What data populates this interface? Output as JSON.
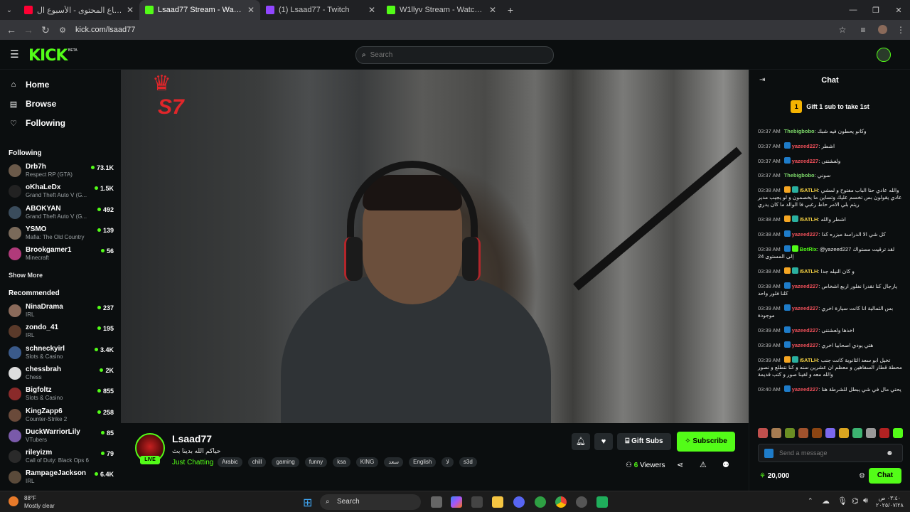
{
  "browser": {
    "tabs": [
      {
        "title": "دوري صناع المحتوى - الأسبوع ال",
        "active": false,
        "fav_color": "#ff0033"
      },
      {
        "title": "Lsaad77 Stream - Watch Live on",
        "active": true,
        "fav_color": "#53fc18"
      },
      {
        "title": "(1) Lsaad77 - Twitch",
        "active": false,
        "fav_color": "#9146ff"
      },
      {
        "title": "W1llyv Stream - Watch Live on",
        "active": false,
        "fav_color": "#53fc18"
      }
    ],
    "url": "kick.com/lsaad77"
  },
  "header": {
    "logo": "KICK",
    "beta": "BETA",
    "search_placeholder": "Search"
  },
  "sidebar": {
    "nav": [
      {
        "label": "Home",
        "icon": "home-icon",
        "glyph": "⌂"
      },
      {
        "label": "Browse",
        "icon": "browse-icon",
        "glyph": "▤"
      },
      {
        "label": "Following",
        "icon": "heart-icon",
        "glyph": "♡"
      }
    ],
    "following_title": "Following",
    "following": [
      {
        "name": "Drb7h",
        "category": "Respect RP (GTA)",
        "viewers": "73.1K",
        "color": "#6b5a4a"
      },
      {
        "name": "oKhaLeDx",
        "category": "Grand Theft Auto V (G...",
        "viewers": "1.5K",
        "color": "#222222"
      },
      {
        "name": "ABOKYAN",
        "category": "Grand Theft Auto V (G...",
        "viewers": "492",
        "color": "#3a4c5c"
      },
      {
        "name": "YSMO",
        "category": "Mafia: The Old Country",
        "viewers": "139",
        "color": "#7a6a5a"
      },
      {
        "name": "Brookgamer1",
        "category": "Minecraft",
        "viewers": "56",
        "color": "#b03a7a"
      }
    ],
    "show_more": "Show More",
    "recommended_title": "Recommended",
    "recommended": [
      {
        "name": "NinaDrama",
        "category": "IRL",
        "viewers": "237",
        "color": "#8a6a5a"
      },
      {
        "name": "zondo_41",
        "category": "IRL",
        "viewers": "195",
        "color": "#5a3a2a"
      },
      {
        "name": "schneckyirl",
        "category": "Slots & Casino",
        "viewers": "3.4K",
        "color": "#3a5a8a"
      },
      {
        "name": "chessbrah",
        "category": "Chess",
        "viewers": "2K",
        "color": "#dddddd"
      },
      {
        "name": "Bigfoltz",
        "category": "Slots & Casino",
        "viewers": "855",
        "color": "#8a2a2a"
      },
      {
        "name": "KingZapp6",
        "category": "Counter-Strike 2",
        "viewers": "258",
        "color": "#6a4a3a"
      },
      {
        "name": "DuckWarriorLily",
        "category": "VTubers",
        "viewers": "85",
        "color": "#7a5aaa"
      },
      {
        "name": "rileyizm",
        "category": "Call of Duty: Black Ops 6",
        "viewers": "79",
        "color": "#2a2a2a"
      },
      {
        "name": "RampageJackson",
        "category": "IRL",
        "viewers": "6.4K",
        "color": "#5a4a3a"
      }
    ]
  },
  "video": {
    "overlay_text": "S7"
  },
  "stream": {
    "name": "Lsaad77",
    "title": "حياكم الله بدينا بث",
    "live": "LIVE",
    "category": "Just Chatting",
    "tags": [
      "Arabic",
      "chill",
      "gaming",
      "funny",
      "ksa",
      "KING",
      "سعد",
      "English",
      "لا",
      "s3d"
    ],
    "gift_label": "Gift Subs",
    "subscribe_label": "Subscribe",
    "viewers_count": "6",
    "viewers_label": "Viewers"
  },
  "chat": {
    "title": "Chat",
    "gift_rank": "1",
    "gift_banner": "Gift 1 sub to take 1st",
    "messages": [
      {
        "time": "03:37 AM",
        "user": "Thebigbobo",
        "color": "#7dd96a",
        "text": "وكانو يحطون فيه شبك",
        "badges": []
      },
      {
        "time": "03:37 AM",
        "user": "yazeed227",
        "color": "#f0505a",
        "text": "اشطر",
        "badges": [
          "#1e7cc9"
        ]
      },
      {
        "time": "03:37 AM",
        "user": "yazeed227",
        "color": "#f0505a",
        "text": "ولعشتنى",
        "badges": [
          "#1e7cc9"
        ]
      },
      {
        "time": "03:37 AM",
        "user": "Thebigbobo",
        "color": "#7dd96a",
        "text": "سوني",
        "badges": []
      },
      {
        "time": "03:38 AM",
        "user": "i5ATLH",
        "color": "#f5d142",
        "text": "والله عادي حتا الباب مفتوح و لمشي عادي يقولون بس تخسم عليك وتساين ما يخصمون و لو يجيب مدير ريثم بلي الامر حاط رغبي فا الوالد ما كان يدري",
        "badges": [
          "#f5a623",
          "#2ab0a0"
        ]
      },
      {
        "time": "03:38 AM",
        "user": "i5ATLH",
        "color": "#f5d142",
        "text": "اشطر والله",
        "badges": [
          "#f5a623",
          "#2ab0a0"
        ]
      },
      {
        "time": "03:38 AM",
        "user": "yazeed227",
        "color": "#f0505a",
        "text": "كل شي الا الدراسة مبزره كذا",
        "badges": [
          "#1e7cc9"
        ]
      },
      {
        "time": "03:38 AM",
        "user": "BotRix",
        "color": "#53fc18",
        "text": "@yazeed227 لقد ترقيت مستواك إلى المستوى 24",
        "badges": [
          "#1e7cc9",
          "#53fc18"
        ]
      },
      {
        "time": "03:38 AM",
        "user": "i5ATLH",
        "color": "#f5d142",
        "text": "و كان النيله جدا",
        "badges": [
          "#f5a623",
          "#2ab0a0"
        ]
      },
      {
        "time": "03:38 AM",
        "user": "yazeed227",
        "color": "#f0505a",
        "text": "يارجال كنا نقدرا نفلور اربع اشخاص كلنا فلور واحد",
        "badges": [
          "#1e7cc9"
        ]
      },
      {
        "time": "03:39 AM",
        "user": "yazeed227",
        "color": "#f0505a",
        "text": "بس الثمالية انا كانت سيارة اخري موجودة",
        "badges": [
          "#1e7cc9"
        ]
      },
      {
        "time": "03:39 AM",
        "user": "yazeed227",
        "color": "#f0505a",
        "text": "اخذها ولعشتنى",
        "badges": [
          "#1e7cc9"
        ]
      },
      {
        "time": "03:39 AM",
        "user": "yazeed227",
        "color": "#f0505a",
        "text": "هتي يودي اصحابيا اخري",
        "badges": [
          "#1e7cc9"
        ]
      },
      {
        "time": "03:39 AM",
        "user": "i5ATLH",
        "color": "#f5d142",
        "text": "تخيل ابو سعد الثانوية كانت جنب محطة قطار السفاهين و معظم ان عشرين سنه و كنا نتطلع و نصور والله معه و لقينا صور و كتب قديمة",
        "badges": [
          "#f5a623",
          "#2ab0a0"
        ]
      },
      {
        "time": "03:40 AM",
        "user": "yazeed227",
        "color": "#f0505a",
        "text": "يحتي مال في شي يبطل للشرطة هنا",
        "badges": [
          "#1e7cc9"
        ]
      }
    ],
    "input_placeholder": "Send a message",
    "points": "20,000",
    "chat_button": "Chat"
  },
  "taskbar": {
    "temp": "88°F",
    "weather": "Mostly clear",
    "search": "Search",
    "time": "٠٣:٤٠ ص",
    "date": "٢٠٢٥/٠٧/٢٨"
  }
}
